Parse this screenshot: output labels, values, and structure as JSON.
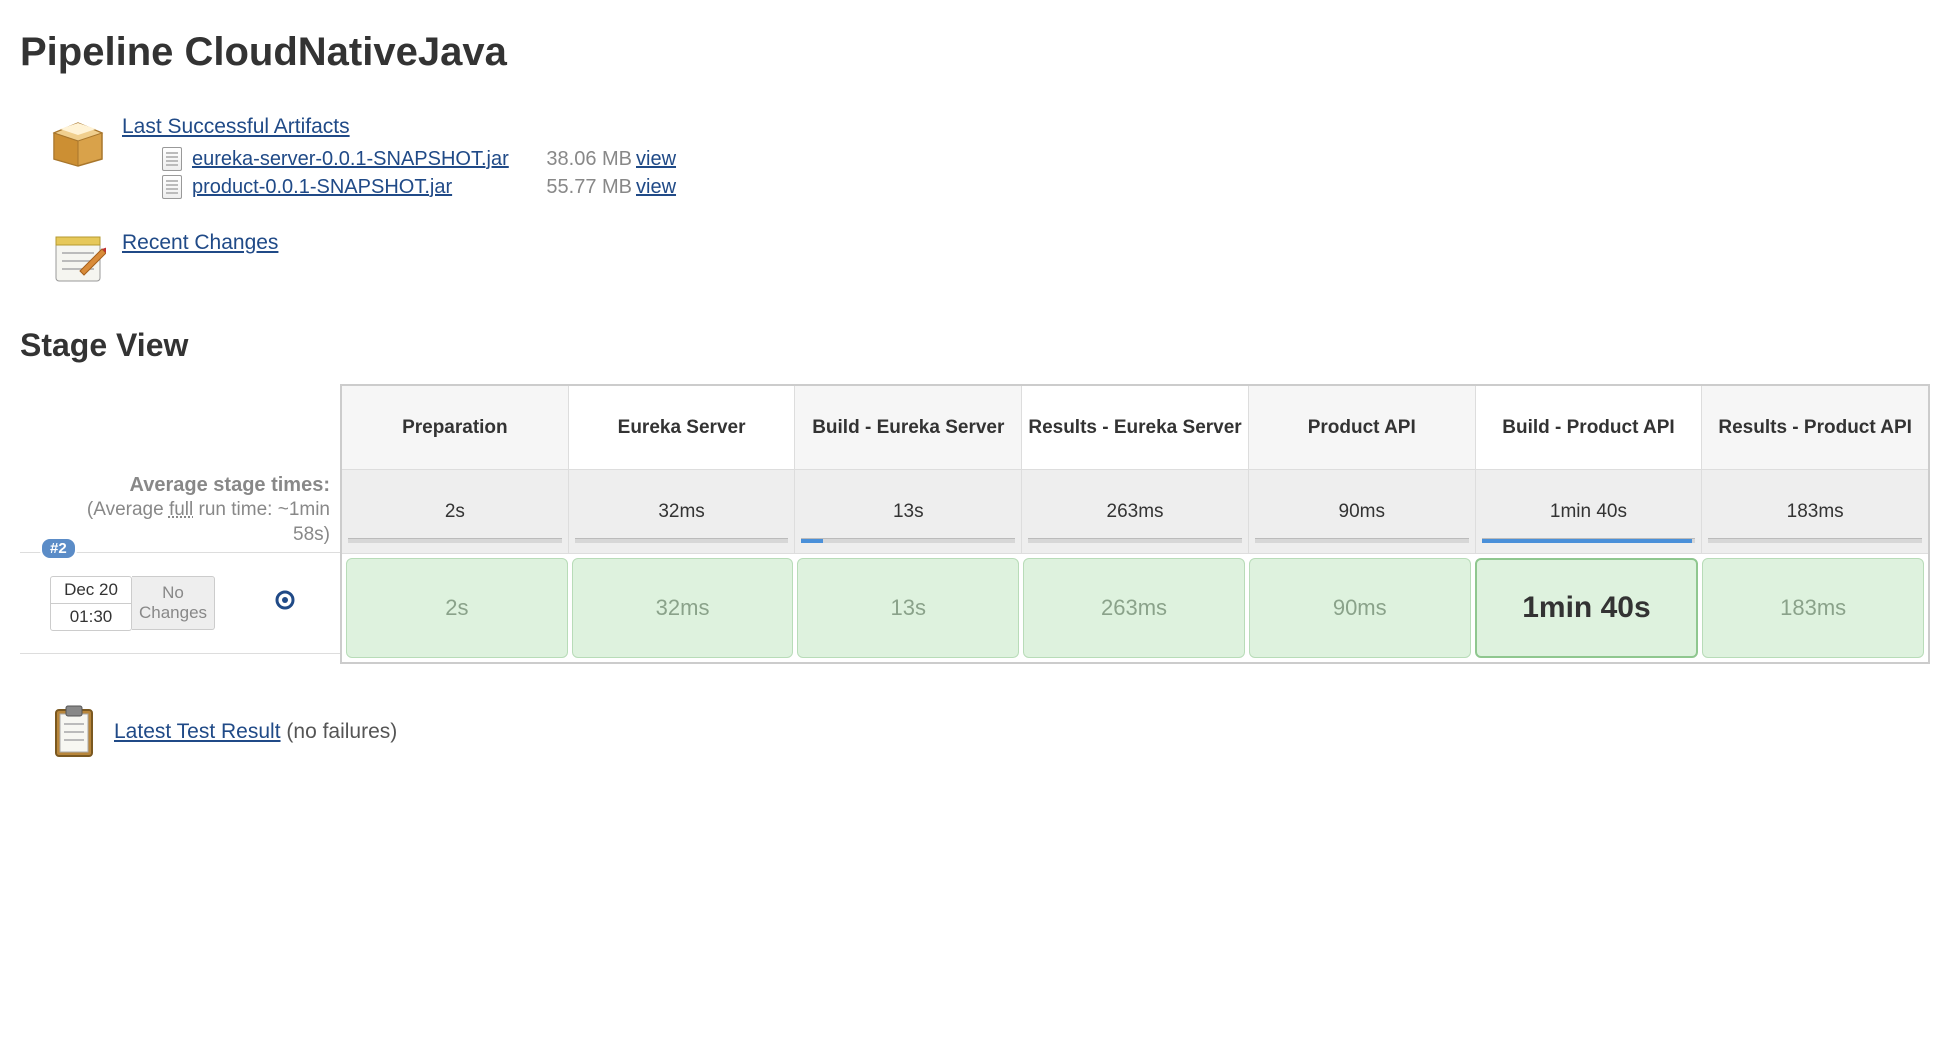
{
  "page_title": "Pipeline CloudNativeJava",
  "artifacts": {
    "header": "Last Successful Artifacts",
    "view_label": "view",
    "items": [
      {
        "name": "eureka-server-0.0.1-SNAPSHOT.jar",
        "size": "38.06 MB"
      },
      {
        "name": "product-0.0.1-SNAPSHOT.jar",
        "size": "55.77 MB"
      }
    ]
  },
  "recent_changes_label": "Recent Changes",
  "stage_view_title": "Stage View",
  "avg_label_line1": "Average stage times:",
  "avg_label_line2_a": "(Average ",
  "avg_label_line2_full": "full",
  "avg_label_line2_b": " run time: ~1min",
  "avg_label_line3": "58s)",
  "stages": [
    {
      "name": "Preparation",
      "avg": "2s",
      "fill_pct": 2,
      "alt": false
    },
    {
      "name": "Eureka Server",
      "avg": "32ms",
      "fill_pct": 1,
      "alt": true
    },
    {
      "name": "Build - Eureka Server",
      "avg": "13s",
      "fill_pct": 12,
      "alt": false
    },
    {
      "name": "Results - Eureka Server",
      "avg": "263ms",
      "fill_pct": 1,
      "alt": true
    },
    {
      "name": "Product API",
      "avg": "90ms",
      "fill_pct": 1,
      "alt": false
    },
    {
      "name": "Build - Product API",
      "avg": "1min 40s",
      "fill_pct": 96,
      "alt": true
    },
    {
      "name": "Results - Product API",
      "avg": "183ms",
      "fill_pct": 1,
      "alt": false
    }
  ],
  "run": {
    "badge": "#2",
    "date": "Dec 20",
    "time": "01:30",
    "changes": "No Changes",
    "cells": [
      {
        "value": "2s",
        "emph": false
      },
      {
        "value": "32ms",
        "emph": false
      },
      {
        "value": "13s",
        "emph": false
      },
      {
        "value": "263ms",
        "emph": false
      },
      {
        "value": "90ms",
        "emph": false
      },
      {
        "value": "1min 40s",
        "emph": true
      },
      {
        "value": "183ms",
        "emph": false
      }
    ]
  },
  "test_result": {
    "link": "Latest Test Result",
    "status": "(no failures)"
  }
}
